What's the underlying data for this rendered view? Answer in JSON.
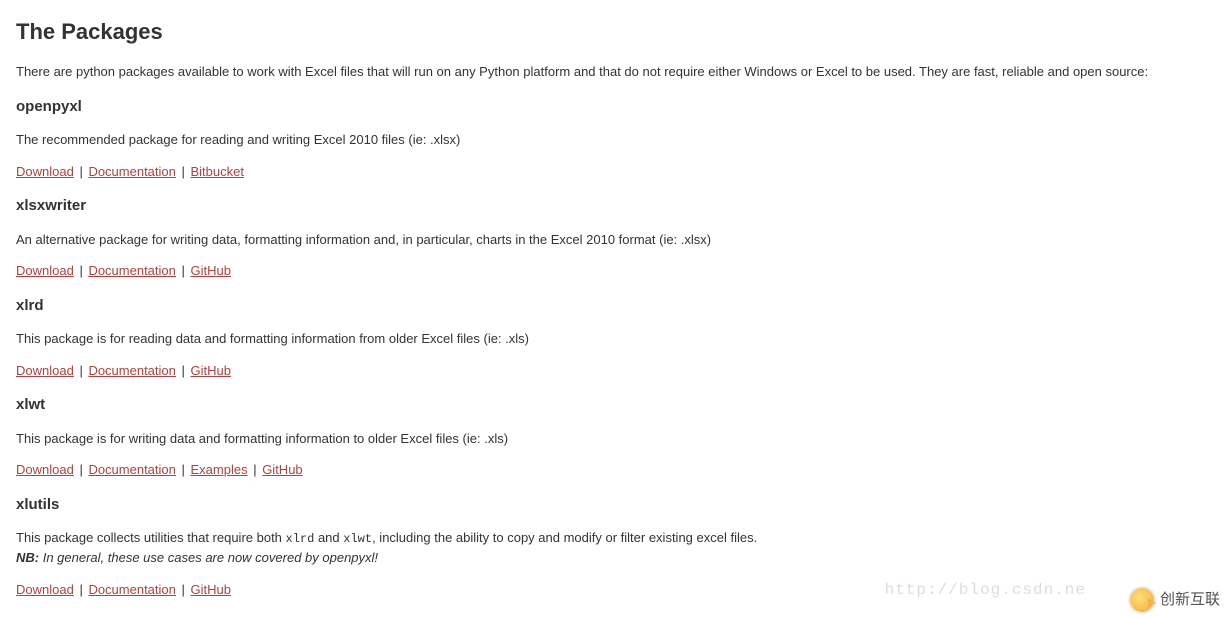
{
  "heading": "The Packages",
  "intro": "There are python packages available to work with Excel files that will run on any Python platform and that do not require either Windows or Excel to be used. They are fast, reliable and open source:",
  "packages": {
    "openpyxl": {
      "title": "openpyxl",
      "desc": "The recommended package for reading and writing Excel 2010 files (ie: .xlsx)",
      "links": {
        "download": "Download",
        "documentation": "Documentation",
        "bitbucket": "Bitbucket"
      }
    },
    "xlsxwriter": {
      "title": "xlsxwriter",
      "desc": "An alternative package for writing data, formatting information and, in particular, charts in the Excel 2010 format (ie: .xlsx)",
      "links": {
        "download": "Download",
        "documentation": "Documentation",
        "github": "GitHub"
      }
    },
    "xlrd": {
      "title": "xlrd",
      "desc": "This package is for reading data and formatting information from older Excel files (ie: .xls)",
      "links": {
        "download": "Download",
        "documentation": "Documentation",
        "github": "GitHub"
      }
    },
    "xlwt": {
      "title": "xlwt",
      "desc": "This package is for writing data and formatting information to older Excel files (ie: .xls)",
      "links": {
        "download": "Download",
        "documentation": "Documentation",
        "examples": "Examples",
        "github": "GitHub"
      }
    },
    "xlutils": {
      "title": "xlutils",
      "desc_pre": "This package collects utilities that require both ",
      "desc_code1": "xlrd",
      "desc_mid": " and ",
      "desc_code2": "xlwt",
      "desc_post": ", including the ability to copy and modify or filter existing excel files.",
      "nb_label": "NB:",
      "nb_text": " In general, these use cases are now covered by openpyxl!",
      "links": {
        "download": "Download",
        "documentation": "Documentation",
        "github": "GitHub"
      }
    }
  },
  "sep": " | ",
  "watermark": {
    "url": "http://blog.csdn.ne",
    "logo_text": "创新互联"
  }
}
